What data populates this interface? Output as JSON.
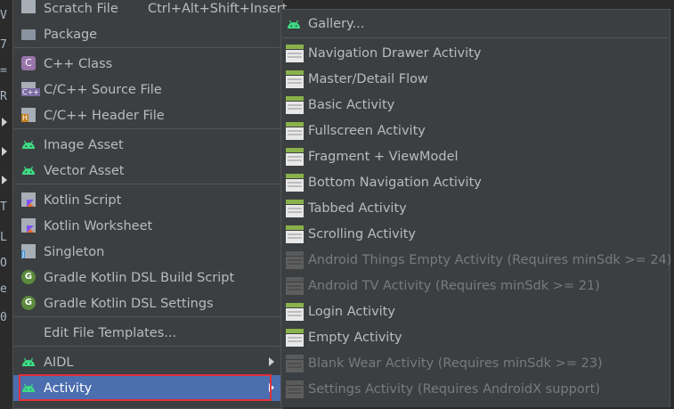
{
  "editor_left_chars": [
    "V",
    "7",
    "=",
    "R",
    "",
    "",
    "",
    "T",
    "L",
    "O",
    "e",
    "0"
  ],
  "new_menu": {
    "items": [
      {
        "label": "Scratch File",
        "shortcut": "Ctrl+Alt+Shift+Insert",
        "icon": "scratch-file-icon"
      },
      {
        "label": "Package",
        "icon": "package-folder-icon"
      },
      {
        "label": "C++ Class",
        "icon": "cpp-class-icon"
      },
      {
        "label": "C/C++ Source File",
        "icon": "cpp-source-file-icon"
      },
      {
        "label": "C/C++ Header File",
        "icon": "cpp-header-file-icon"
      },
      {
        "label": "Image Asset",
        "icon": "android-icon"
      },
      {
        "label": "Vector Asset",
        "icon": "android-icon"
      },
      {
        "label": "Kotlin Script",
        "icon": "kotlin-script-icon"
      },
      {
        "label": "Kotlin Worksheet",
        "icon": "kotlin-worksheet-icon"
      },
      {
        "label": "Singleton",
        "icon": "singleton-icon"
      },
      {
        "label": "Gradle Kotlin DSL Build Script",
        "icon": "gradle-icon"
      },
      {
        "label": "Gradle Kotlin DSL Settings",
        "icon": "gradle-icon"
      },
      {
        "label": "Edit File Templates..."
      },
      {
        "label": "AIDL",
        "icon": "android-icon"
      },
      {
        "label": "Activity",
        "icon": "android-icon"
      }
    ],
    "icon_text": {
      "cpp_class": "C",
      "cpp_source": "C++",
      "cpp_header": "H",
      "gradle": "G"
    }
  },
  "activity_menu": {
    "gallery": "Gallery...",
    "items": [
      {
        "label": "Navigation Drawer Activity",
        "enabled": true
      },
      {
        "label": "Master/Detail Flow",
        "enabled": true
      },
      {
        "label": "Basic Activity",
        "enabled": true
      },
      {
        "label": "Fullscreen Activity",
        "enabled": true
      },
      {
        "label": "Fragment + ViewModel",
        "enabled": true
      },
      {
        "label": "Bottom Navigation Activity",
        "enabled": true
      },
      {
        "label": "Tabbed Activity",
        "enabled": true
      },
      {
        "label": "Scrolling Activity",
        "enabled": true
      },
      {
        "label": "Android Things Empty Activity (Requires minSdk >= 24)",
        "enabled": false
      },
      {
        "label": "Android TV Activity (Requires minSdk >= 21)",
        "enabled": false
      },
      {
        "label": "Login Activity",
        "enabled": true
      },
      {
        "label": "Empty Activity",
        "enabled": true
      },
      {
        "label": "Blank Wear Activity (Requires minSdk >= 23)",
        "enabled": false
      },
      {
        "label": "Settings Activity (Requires AndroidX support)",
        "enabled": false
      }
    ]
  },
  "colors": {
    "menu_bg": "#3c3f41",
    "selection": "#4b6eaf",
    "android_green": "#3ddc84",
    "highlight_border": "#e0303a"
  }
}
